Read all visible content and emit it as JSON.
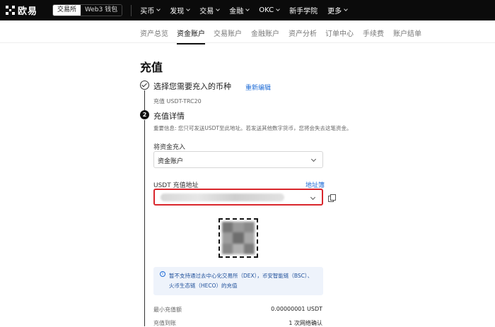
{
  "topnav": {
    "brand": "欧易",
    "switch": {
      "exchange": "交易所",
      "web3": "Web3 钱包"
    },
    "menu": [
      "买币",
      "发现",
      "交易",
      "金融",
      "OKC",
      "新手学院",
      "更多"
    ]
  },
  "subnav": {
    "tabs": [
      "资产总览",
      "资金账户",
      "交易账户",
      "金融账户",
      "资产分析",
      "订单中心",
      "手续费",
      "账户结单"
    ],
    "active_index": 1
  },
  "page": {
    "title": "充值",
    "step1": {
      "title": "选择您需要充入的币种",
      "edit": "重新编辑",
      "summary": "充值 USDT-TRC20",
      "number": ""
    },
    "step2": {
      "number": "2",
      "title": "充值详情",
      "warning": "重要信息: 您只可发送USDT至此地址。若发送其他数字货币，您将会失去这笔资金。",
      "deposit_to_label": "将资金充入",
      "deposit_to_value": "资金账户",
      "address_label": "USDT 充值地址",
      "address_book": "地址簿",
      "notice_lines": [
        "暂不支持通过去中心化交易所（DEX），币安智能链（BSC）、",
        "火币生态链（HECO）的充值"
      ],
      "min_deposit_label": "最小充值额",
      "min_deposit_value": "0.00000001 USDT",
      "arrival_label": "充值到账",
      "arrival_value": "1 次网络确认"
    }
  }
}
